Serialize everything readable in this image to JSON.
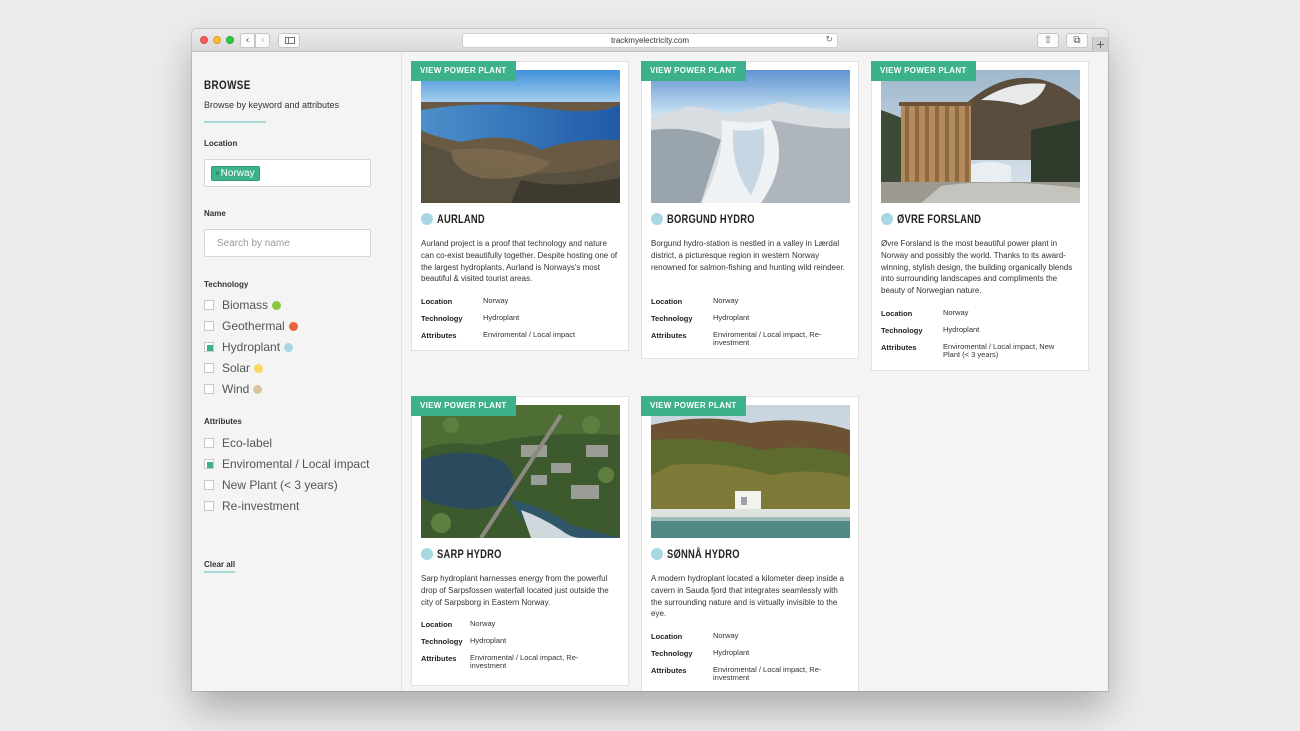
{
  "browser": {
    "url": "trackmyelectricity.com"
  },
  "sidebar": {
    "title": "BROWSE",
    "subtitle": "Browse by keyword and attributes",
    "location_label": "Location",
    "location_tag": "Norway",
    "name_label": "Name",
    "name_placeholder": "Search by name",
    "technology_label": "Technology",
    "technology": [
      {
        "label": "Biomass",
        "checked": false,
        "color": "#8dc63f"
      },
      {
        "label": "Geothermal",
        "checked": false,
        "color": "#e8643c"
      },
      {
        "label": "Hydroplant",
        "checked": true,
        "color": "#a6d7e2"
      },
      {
        "label": "Solar",
        "checked": false,
        "color": "#fcd660"
      },
      {
        "label": "Wind",
        "checked": false,
        "color": "#d8c4a0"
      }
    ],
    "attributes_label": "Attributes",
    "attributes": [
      {
        "label": "Eco-label",
        "checked": false
      },
      {
        "label": "Enviromental / Local impact",
        "checked": true
      },
      {
        "label": "New Plant (< 3 years)",
        "checked": false
      },
      {
        "label": "Re-investment",
        "checked": false
      }
    ],
    "clear_label": "Clear all"
  },
  "labels": {
    "view": "VIEW POWER PLANT",
    "location": "Location",
    "technology": "Technology",
    "attributes": "Attributes"
  },
  "plants": [
    {
      "name": "AURLAND",
      "description": "Aurland project is a proof that technology and nature can co-exist beautifully together. Despite hosting one of the largest hydroplants, Aurland is Norways's most beautiful & visited tourist areas.",
      "location": "Norway",
      "technology": "Hydroplant",
      "attributes": "Enviromental / Local impact"
    },
    {
      "name": "BORGUND HYDRO",
      "description": "Borgund hydro-station is nestled in a valley in Lærdal district, a picturesque region in western Norway renowned for salmon-fishing and hunting wild reindeer.",
      "location": "Norway",
      "technology": "Hydroplant",
      "attributes": "Enviromental / Local impact, Re-investment"
    },
    {
      "name": "ØVRE FORSLAND",
      "description": "Øvre Forsland is the most beautiful power plant in Norway and possibly the world. Thanks to its award-winning, stylish design, the building organically blends into surrounding landscapes and compliments the beauty of Norwegian nature.",
      "location": "Norway",
      "technology": "Hydroplant",
      "attributes": "Enviromental / Local impact, New Plant (< 3 years)"
    },
    {
      "name": "SARP HYDRO",
      "description": "Sarp hydroplant harnesses energy from the powerful drop of Sarpsfossen waterfall located just outside the city of Sarpsborg in Eastern Norway.",
      "location": "Norway",
      "technology": "Hydroplant",
      "attributes": "Enviromental / Local impact, Re-investment"
    },
    {
      "name": "SØNNÅ HYDRO",
      "description": "A modern hydroplant located a kilometer deep inside a cavern in Sauda fjord that integrates seamlessly with the surrounding nature and is virtually invisible to the eye.",
      "location": "Norway",
      "technology": "Hydroplant",
      "attributes": "Enviromental / Local impact, Re-investment"
    }
  ]
}
